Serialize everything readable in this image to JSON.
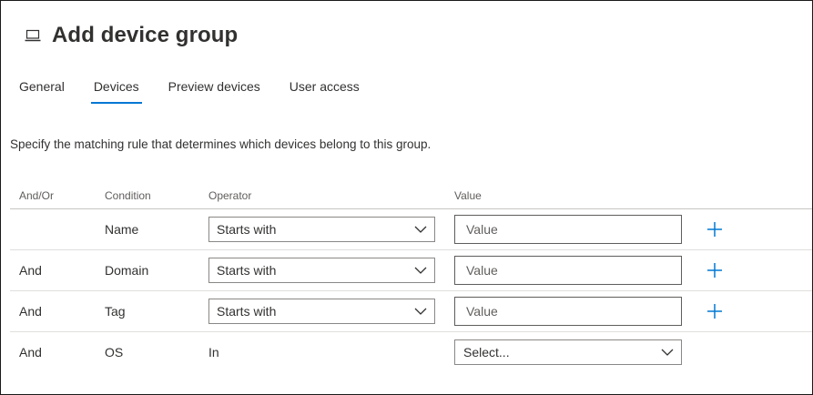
{
  "page": {
    "title": "Add device group",
    "icon": "laptop-icon"
  },
  "tabs": [
    {
      "label": "General",
      "active": false
    },
    {
      "label": "Devices",
      "active": true
    },
    {
      "label": "Preview devices",
      "active": false
    },
    {
      "label": "User access",
      "active": false
    }
  ],
  "description": "Specify the matching rule that determines which devices belong to this group.",
  "table": {
    "headers": {
      "and_or": "And/Or",
      "condition": "Condition",
      "operator": "Operator",
      "value": "Value"
    },
    "rows": [
      {
        "and_or": "",
        "condition": "Name",
        "operator": "Starts with",
        "value_placeholder": "Value"
      },
      {
        "and_or": "And",
        "condition": "Domain",
        "operator": "Starts with",
        "value_placeholder": "Value"
      },
      {
        "and_or": "And",
        "condition": "Tag",
        "operator": "Starts with",
        "value_placeholder": "Value"
      },
      {
        "and_or": "And",
        "condition": "OS",
        "operator": "In",
        "value_select": "Select..."
      }
    ]
  },
  "colors": {
    "accent": "#0078d4",
    "text": "#323130",
    "muted": "#605e5c"
  }
}
